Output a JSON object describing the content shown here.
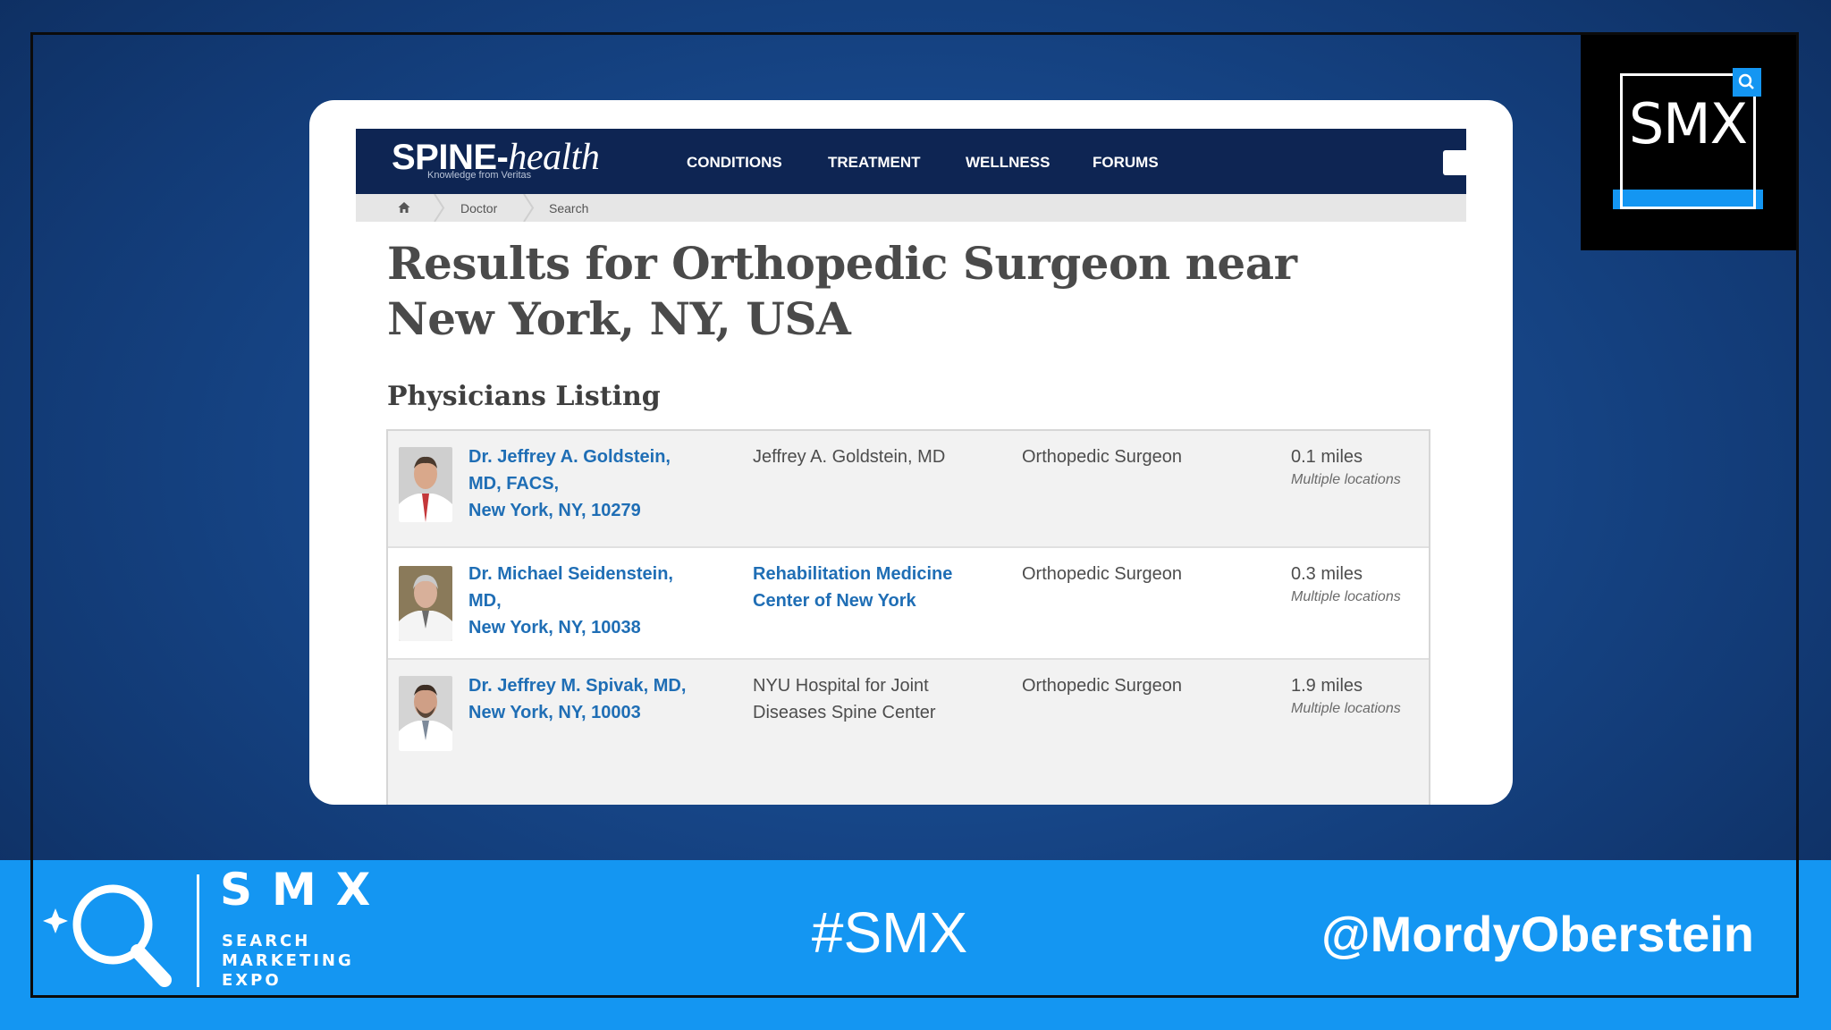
{
  "site": {
    "logo_main": "SPINE-",
    "logo_script": "health",
    "logo_tagline": "Knowledge from Veritas",
    "nav": [
      "CONDITIONS",
      "TREATMENT",
      "WELLNESS",
      "FORUMS"
    ],
    "breadcrumb": [
      "Doctor",
      "Search"
    ],
    "page_title": "Results for Orthopedic Surgeon near New York, NY, USA",
    "section_title": "Physicians Listing",
    "rows": [
      {
        "name": "Dr. Jeffrey A. Goldstein, MD, FACS,",
        "location": "New York, NY, 10279",
        "practice": "Jeffrey A. Goldstein, MD",
        "specialty": "Orthopedic Surgeon",
        "distance": "0.1 miles",
        "locations_note": "Multiple locations"
      },
      {
        "name": "Dr. Michael Seidenstein, MD,",
        "location": "New York, NY, 10038",
        "practice": "Rehabilitation Medicine Center of New York",
        "specialty": "Orthopedic Surgeon",
        "distance": "0.3 miles",
        "locations_note": "Multiple locations"
      },
      {
        "name": "Dr. Jeffrey M. Spivak, MD,",
        "location": "New York, NY, 10003",
        "practice": "NYU Hospital for Joint Diseases Spine Center",
        "specialty": "Orthopedic Surgeon",
        "distance": "1.9 miles",
        "locations_note": "Multiple locations"
      }
    ]
  },
  "slide": {
    "logo_text": "SMX",
    "brand_big": "SMX",
    "brand_sub": [
      "SEARCH",
      "MARKETING",
      "EXPO"
    ],
    "hashtag": "#SMX",
    "handle": "@MordyOberstein"
  },
  "colors": {
    "accent_blue": "#1496f2",
    "nav_navy": "#0e2553",
    "link_blue": "#1f6eb5"
  }
}
